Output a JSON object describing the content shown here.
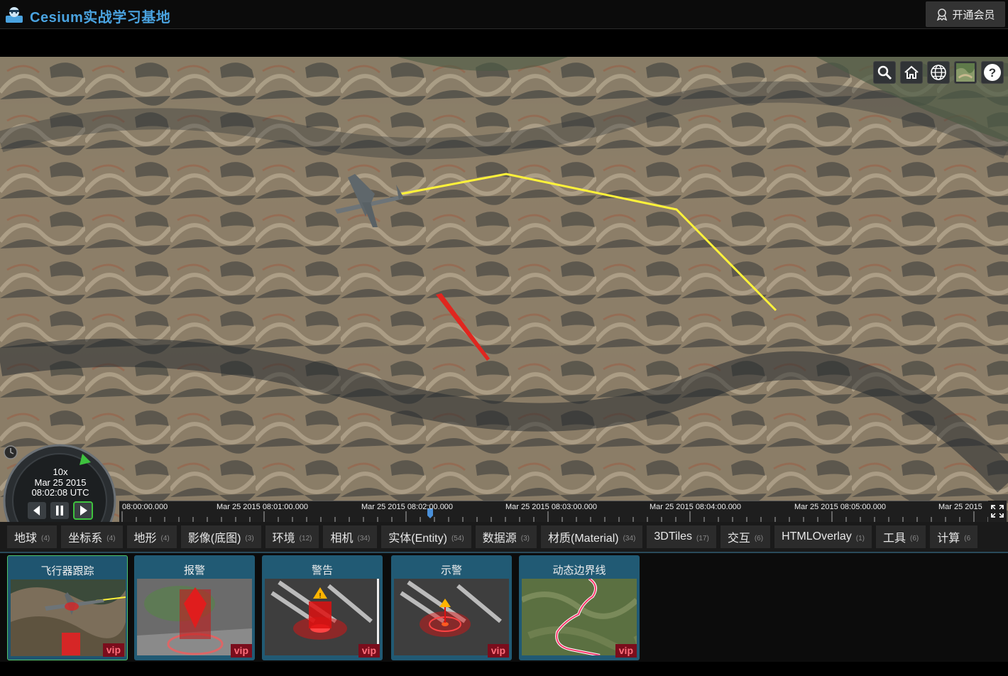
{
  "header": {
    "title": "Cesium实战学习基地",
    "vip_button": "开通会员"
  },
  "viewer": {
    "toolbar": [
      "search-icon",
      "home-icon",
      "globe-icon",
      "imagery-icon",
      "help-icon"
    ],
    "help_label": "?"
  },
  "clock": {
    "speed": "10x",
    "date": "Mar 25 2015",
    "time": "08:02:08 UTC"
  },
  "timeline": {
    "labels": [
      "08:00:00.000",
      "Mar 25 2015 08:01:00.000",
      "Mar 25 2015 08:02:00.000",
      "Mar 25 2015 08:03:00.000",
      "Mar 25 2015 08:04:00.000",
      "Mar 25 2015 08:05:00.000",
      "Mar 25 2015"
    ]
  },
  "tabs": [
    {
      "label": "地球",
      "count": "(4)"
    },
    {
      "label": "坐标系",
      "count": "(4)"
    },
    {
      "label": "地形",
      "count": "(4)"
    },
    {
      "label": "影像(底图)",
      "count": "(3)"
    },
    {
      "label": "环境",
      "count": "(12)"
    },
    {
      "label": "相机",
      "count": "(34)"
    },
    {
      "label": "实体(Entity)",
      "count": "(54)"
    },
    {
      "label": "数据源",
      "count": "(3)"
    },
    {
      "label": "材质(Material)",
      "count": "(34)"
    },
    {
      "label": "3DTiles",
      "count": "(17)"
    },
    {
      "label": "交互",
      "count": "(6)"
    },
    {
      "label": "HTMLOverlay",
      "count": "(1)"
    },
    {
      "label": "工具",
      "count": "(6)"
    },
    {
      "label": "计算",
      "count": "(6"
    }
  ],
  "cards": [
    {
      "title": "飞行器跟踪",
      "badge": "vip"
    },
    {
      "title": "报警",
      "badge": "vip"
    },
    {
      "title": "警告",
      "badge": "vip"
    },
    {
      "title": "示警",
      "badge": "vip"
    },
    {
      "title": "动态边界线",
      "badge": "vip"
    }
  ]
}
